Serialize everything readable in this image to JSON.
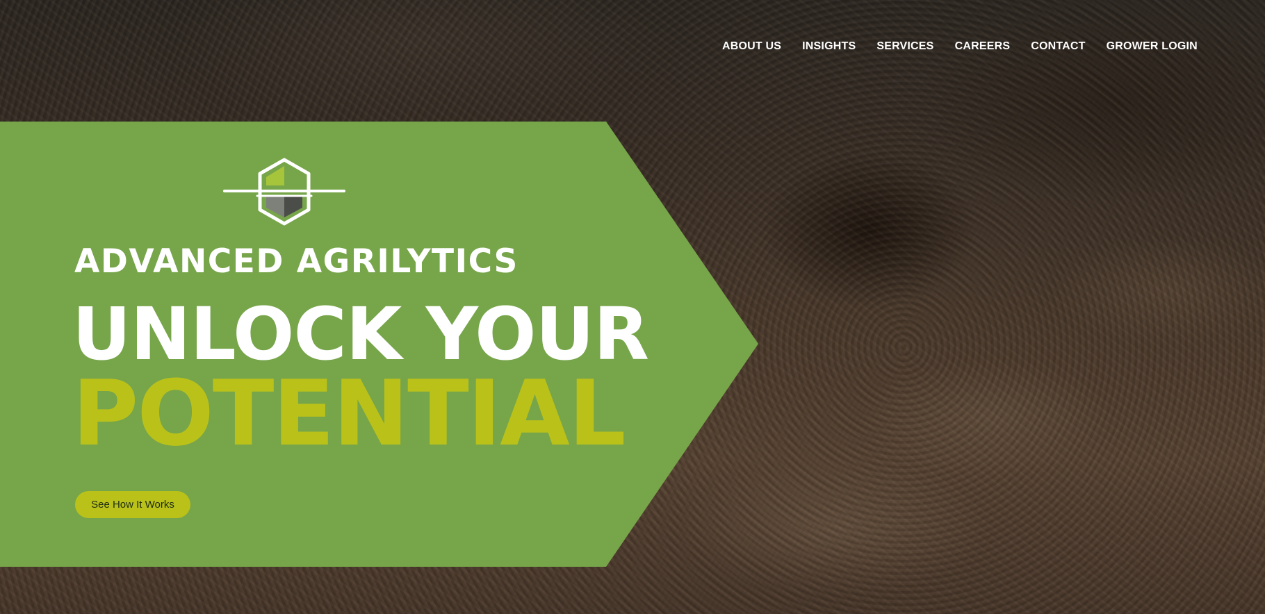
{
  "nav": {
    "items": [
      {
        "label": "ABOUT US"
      },
      {
        "label": "INSIGHTS"
      },
      {
        "label": "SERVICES"
      },
      {
        "label": "CAREERS"
      },
      {
        "label": "CONTACT"
      },
      {
        "label": "GROWER LOGIN"
      }
    ]
  },
  "hero": {
    "brand": "ADVANCED AGRILYTICS",
    "headline_line1": "UNLOCK YOUR",
    "headline_line2": "POTENTIAL",
    "cta_label": "See How It Works"
  },
  "colors": {
    "panel_green": "#77a54a",
    "accent_lime": "#bac21a",
    "text_white": "#ffffff",
    "logo_dark": "#4b4d48",
    "logo_light_green": "#a7c53a"
  },
  "icons": {
    "logo": "hexagon-logo-icon",
    "background": "soil-background"
  }
}
